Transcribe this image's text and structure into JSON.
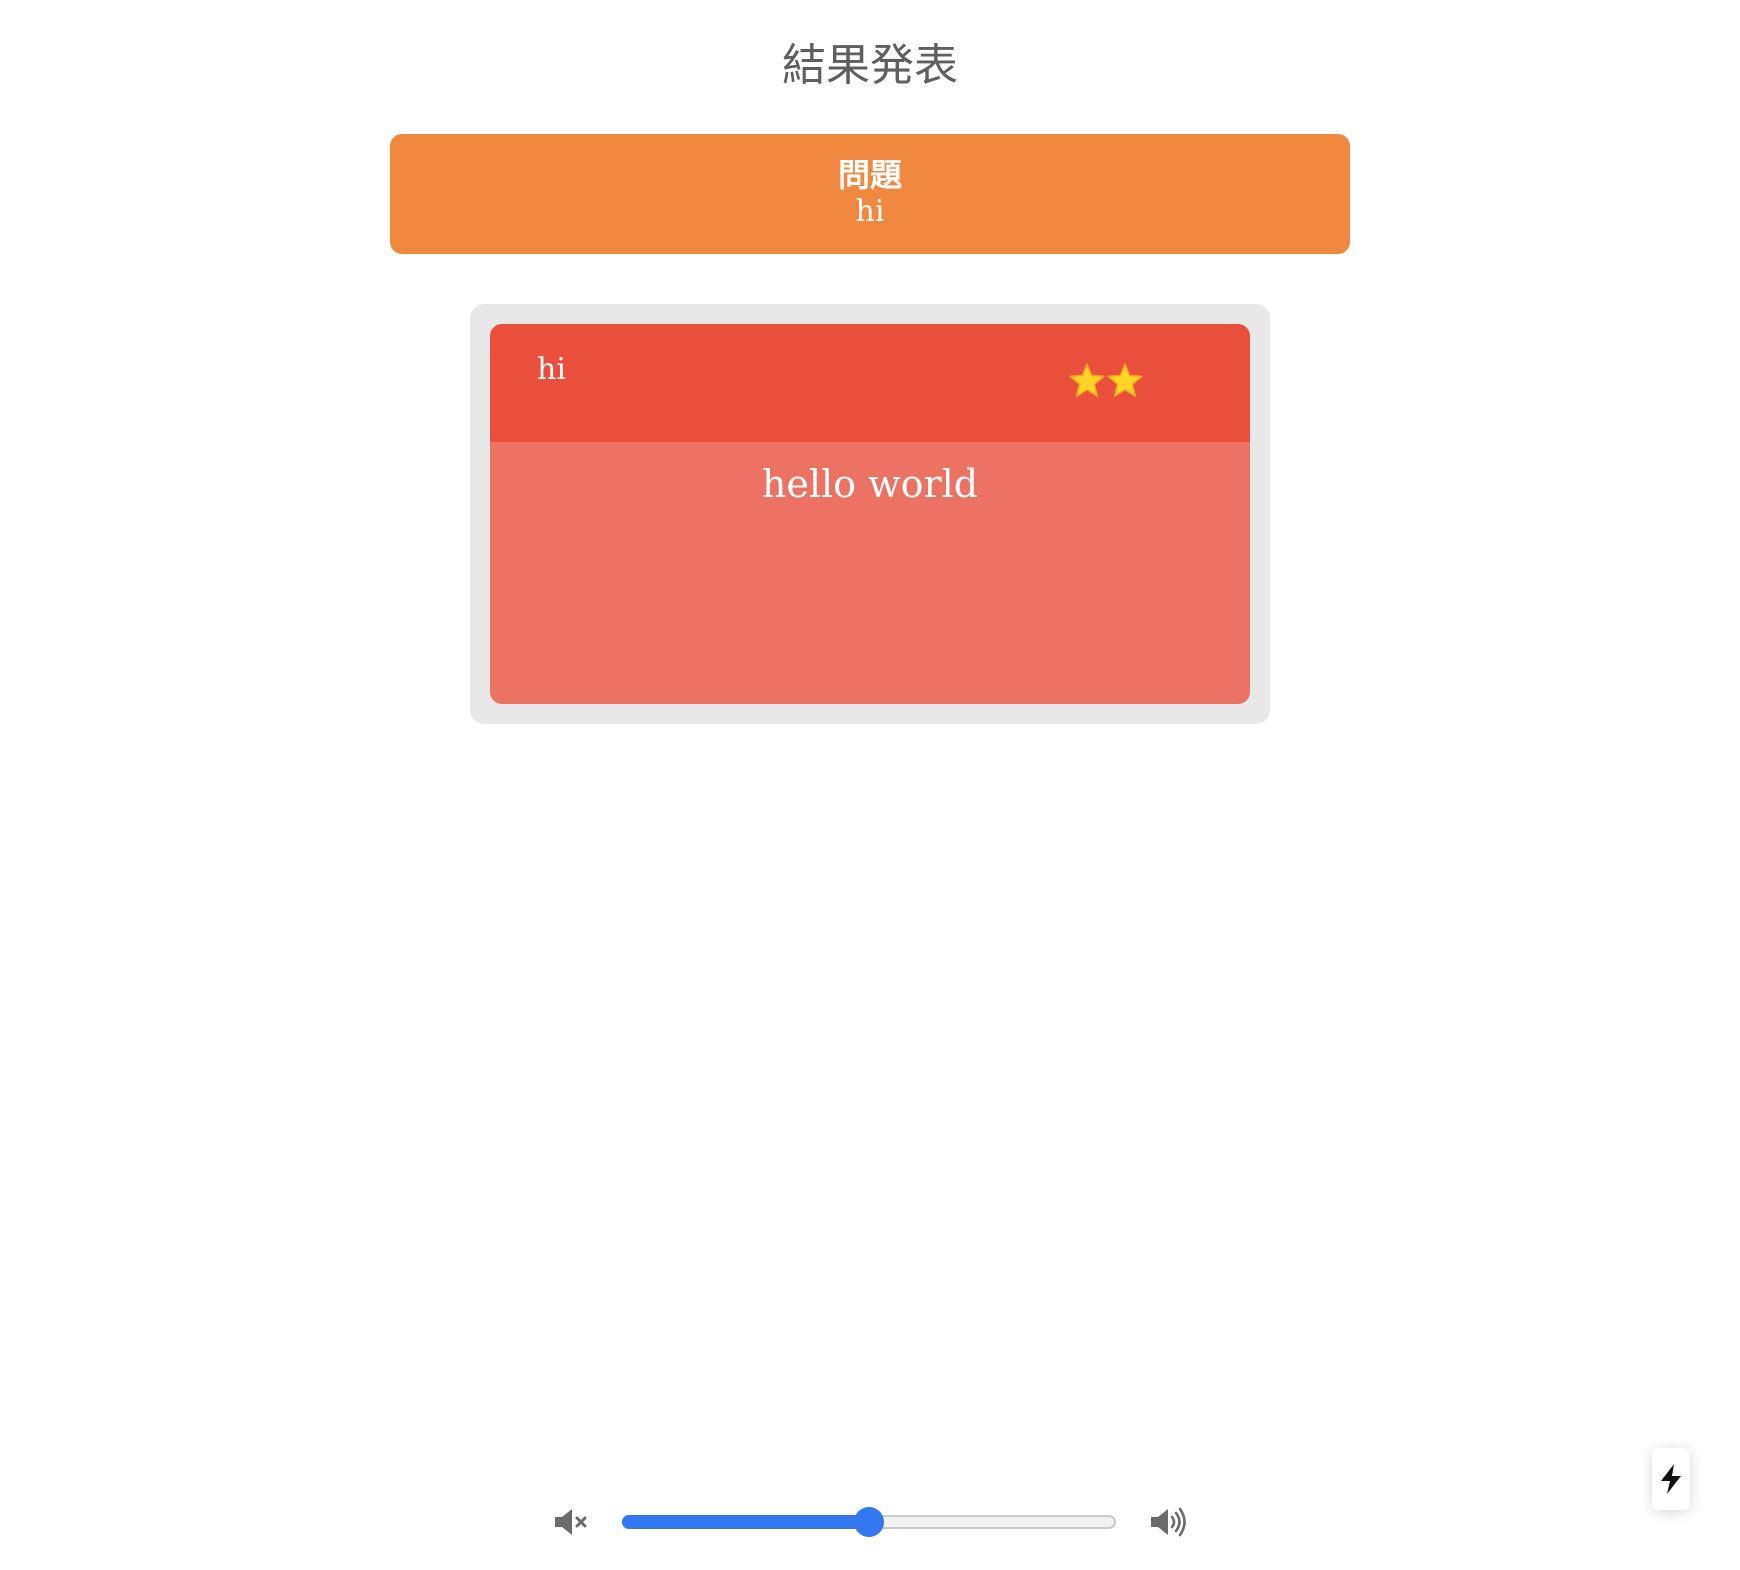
{
  "page": {
    "title": "結果発表"
  },
  "question": {
    "heading": "問題",
    "text": "hi"
  },
  "answer": {
    "player": "hi",
    "text": "hello world",
    "stars": 2,
    "stars_icon": "star-icon"
  },
  "volume": {
    "level": 0.5,
    "mute_icon": "volume-mute-icon",
    "max_icon": "volume-up-icon"
  },
  "devtools": {
    "icon": "lightning-bolt-icon"
  },
  "colors": {
    "question_banner": "#f08840",
    "answer_header": "#ea4f3b",
    "answer_body": "#ec7263",
    "answer_frame": "#e8e8e8",
    "slider_accent": "#3478f0",
    "title_text": "#5f5f5f"
  }
}
